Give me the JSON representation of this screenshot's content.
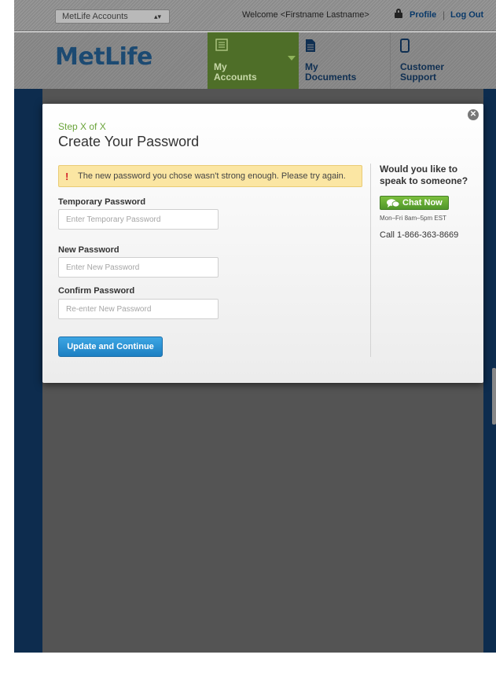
{
  "topbar": {
    "account_select": "MetLife Accounts",
    "welcome": "Welcome <Firstname Lastname>",
    "profile": "Profile",
    "separator": "|",
    "logout": "Log Out"
  },
  "header": {
    "logo": "MetLife",
    "nav": [
      {
        "label_line1": "My",
        "label_line2": "Accounts",
        "icon": "list-icon"
      },
      {
        "label_line1": "My",
        "label_line2": "Documents",
        "icon": "document-icon"
      },
      {
        "label_line1": "Customer",
        "label_line2": "Support",
        "icon": "phone-icon"
      }
    ]
  },
  "modal": {
    "step": "Step X of X",
    "title": "Create Your Password",
    "alert_icon": "!",
    "alert": "The new password you chose wasn't strong enough. Please try again.",
    "fields": [
      {
        "label": "Temporary Password",
        "placeholder": "Enter Temporary Password",
        "value": ""
      },
      {
        "label": "New Password",
        "placeholder": "Enter New Password",
        "value": ""
      },
      {
        "label": "Confirm Password",
        "placeholder": "Re-enter New Password",
        "value": ""
      }
    ],
    "submit": "Update and Continue",
    "close": "✕",
    "help": {
      "title": "Would you like to speak to someone?",
      "chat_button": "Chat Now",
      "hours": "Mon–Fri 8am–5pm EST",
      "phone": "Call 1-866-363-8669"
    }
  },
  "colors": {
    "brand_blue": "#1c4a72",
    "step_green": "#6aa43a",
    "primary_button": "#1c7fc2",
    "chat_green": "#4f962a",
    "alert_bg": "#fbe6a3",
    "alert_icon": "#d2232a"
  }
}
